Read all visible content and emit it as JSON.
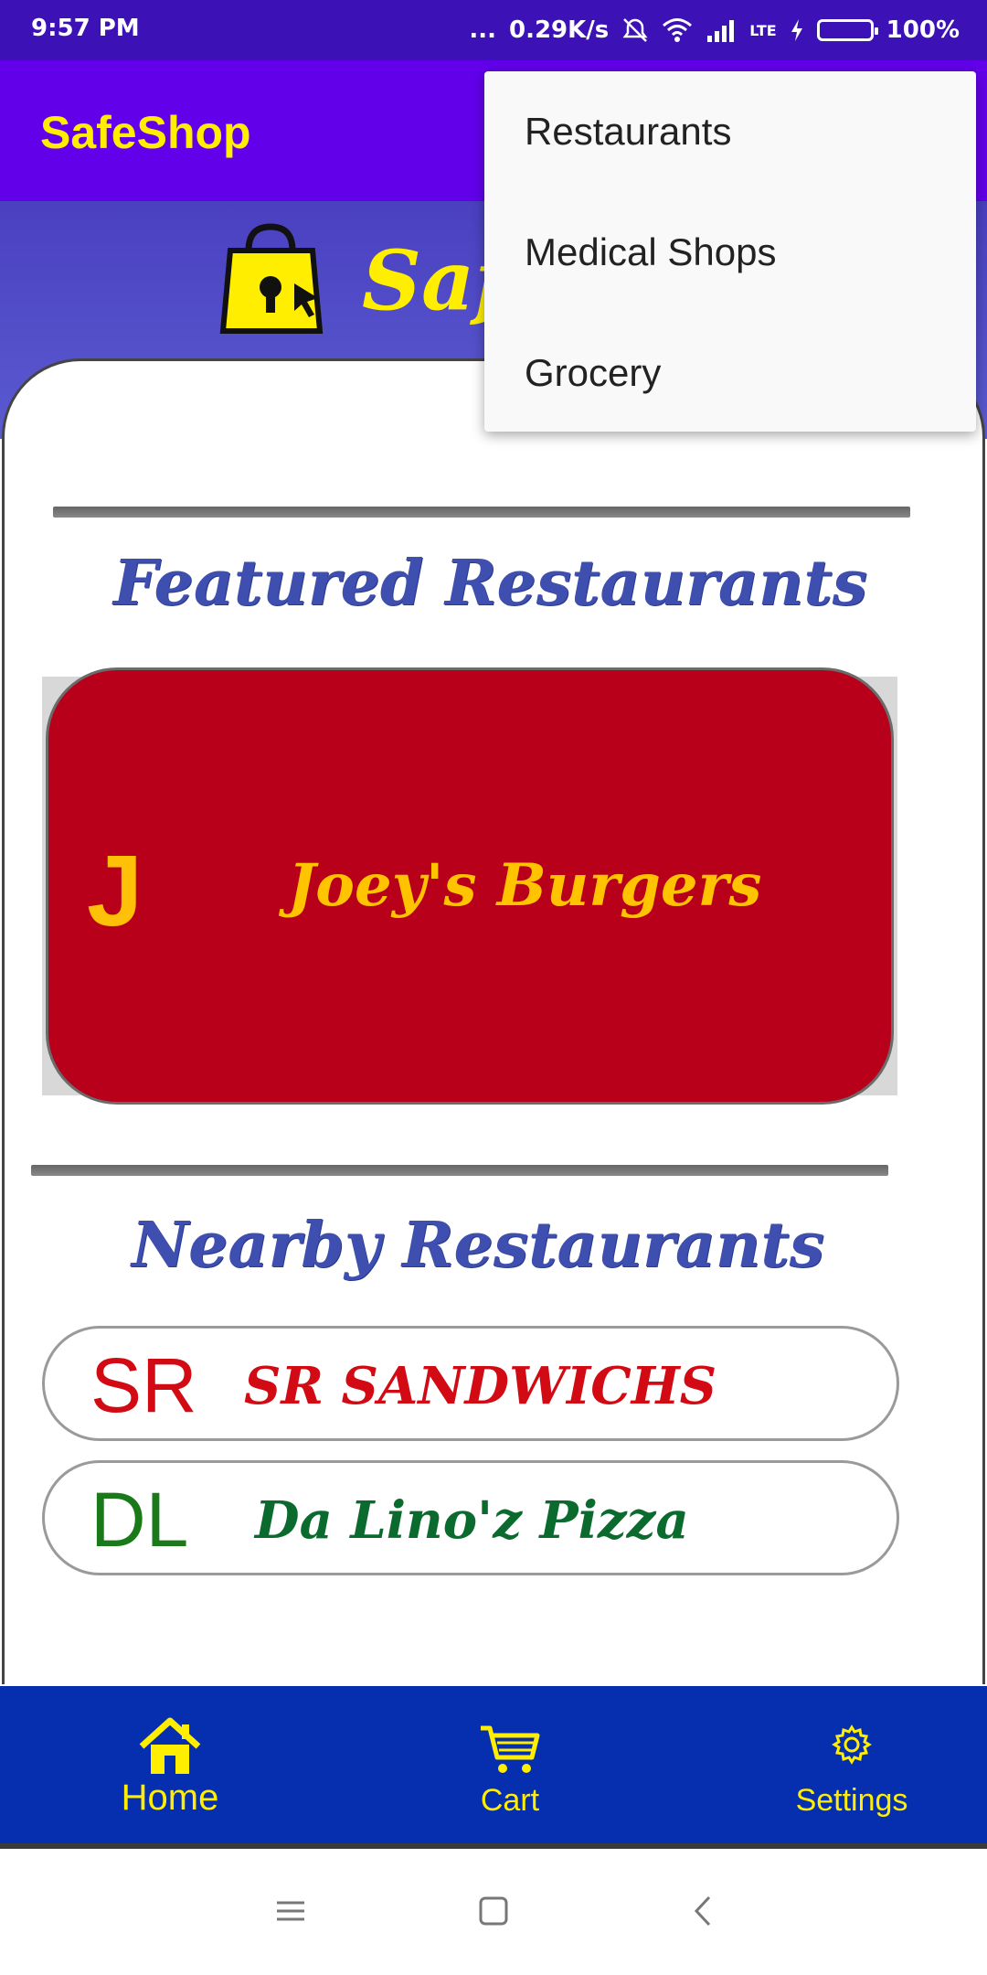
{
  "status_bar": {
    "time": "9:57 PM",
    "dots": "...",
    "net_speed": "0.29K/s",
    "lte": "LTE",
    "battery": "100%"
  },
  "app_bar": {
    "title": "SafeShop"
  },
  "hero": {
    "logo_text": "SafeShop"
  },
  "menu": {
    "items": [
      {
        "label": "Restaurants"
      },
      {
        "label": "Medical Shops"
      },
      {
        "label": "Grocery"
      }
    ]
  },
  "featured": {
    "title": "Featured Restaurants",
    "restaurant": {
      "letter": "J",
      "name": "Joey's Burgers"
    }
  },
  "nearby": {
    "title": "Nearby Restaurants",
    "items": [
      {
        "abbr": "SR",
        "name": "SR SANDWICHS",
        "color": "#d10a14"
      },
      {
        "abbr": "DL",
        "name": "Da Lino'z Pizza",
        "color": "#0b6b2e"
      }
    ]
  },
  "bottom_nav": {
    "items": [
      {
        "label": "Home",
        "icon": "home-icon"
      },
      {
        "label": "Cart",
        "icon": "cart-icon"
      },
      {
        "label": "Settings",
        "icon": "gear-icon"
      }
    ]
  },
  "colors": {
    "app_bar": "#6200ea",
    "accent": "#ffee00",
    "bottom_nav": "#062fb0",
    "featured_card": "#b8001a"
  }
}
